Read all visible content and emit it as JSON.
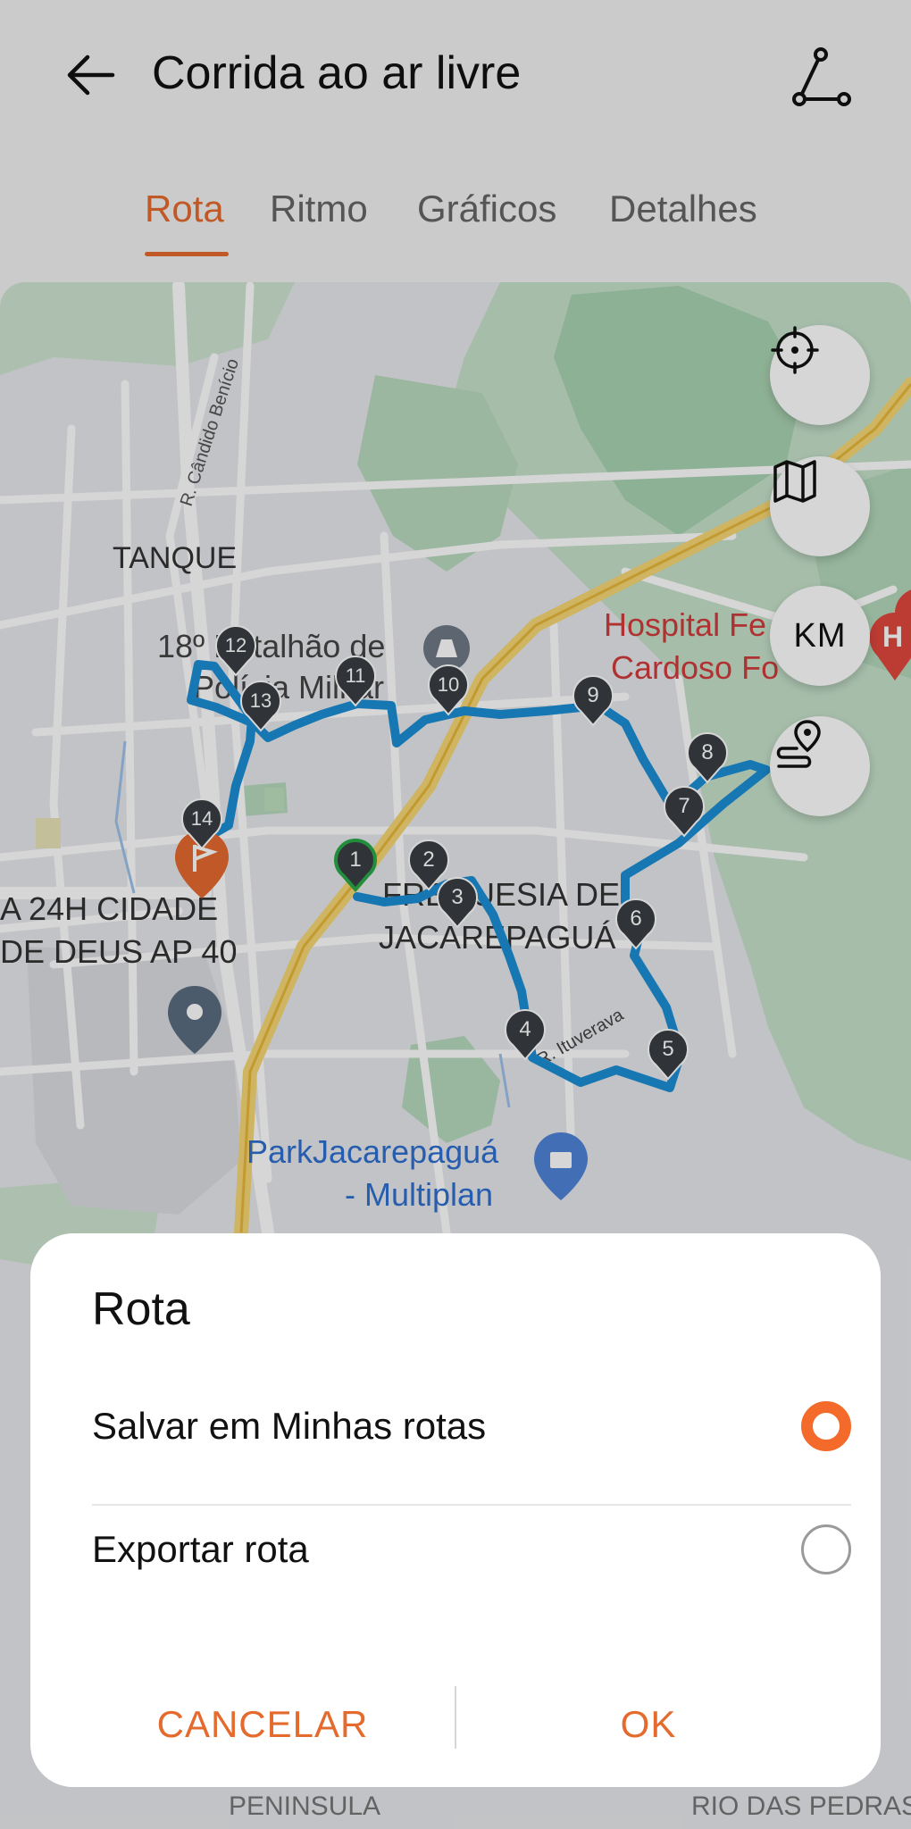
{
  "header": {
    "title": "Corrida ao ar livre",
    "back_icon": "arrow-left-icon",
    "route_icon": "route-share-icon"
  },
  "tabs": [
    {
      "label": "Rota",
      "active": true
    },
    {
      "label": "Ritmo",
      "active": false
    },
    {
      "label": "Gráficos",
      "active": false
    },
    {
      "label": "Detalhes",
      "active": false
    }
  ],
  "map": {
    "labels": {
      "tanque": "TANQUE",
      "batalhao_1": "18º Batalhão de",
      "batalhao_2": "Polícia Militar",
      "hospital_1": "Hospital Fe",
      "hospital_2": "Cardoso Fo",
      "freguesia_1": "FREGUESIA DE",
      "freguesia_2": "JACAREPAGUÁ",
      "cidade_1": "A 24H CIDADE",
      "cidade_2": "DE DEUS AP 40",
      "park_1": "ParkJacarepaguá",
      "park_2": "- Multiplan",
      "street_candido": "R. Cândido Benício",
      "street_ituverava": "R. Ituverava",
      "peninsula": "PENINSULA",
      "rio_das_pedras": "RIO DAS PEDRAS"
    },
    "km_markers": [
      "1",
      "2",
      "3",
      "4",
      "5",
      "6",
      "7",
      "8",
      "9",
      "10",
      "11",
      "12",
      "13",
      "14"
    ],
    "controls": {
      "locate_icon": "crosshair-icon",
      "layers_icon": "map-layers-icon",
      "km_label": "KM",
      "route_icon": "route-pin-icon"
    },
    "colors": {
      "route": "#1c8ed4",
      "start": "#2aa84a",
      "finish": "#e5692f",
      "accent": "#e56a2d"
    }
  },
  "dialog": {
    "title": "Rota",
    "options": [
      {
        "label": "Salvar em Minhas rotas",
        "selected": true
      },
      {
        "label": "Exportar rota",
        "selected": false
      }
    ],
    "cancel": "CANCELAR",
    "ok": "OK"
  }
}
